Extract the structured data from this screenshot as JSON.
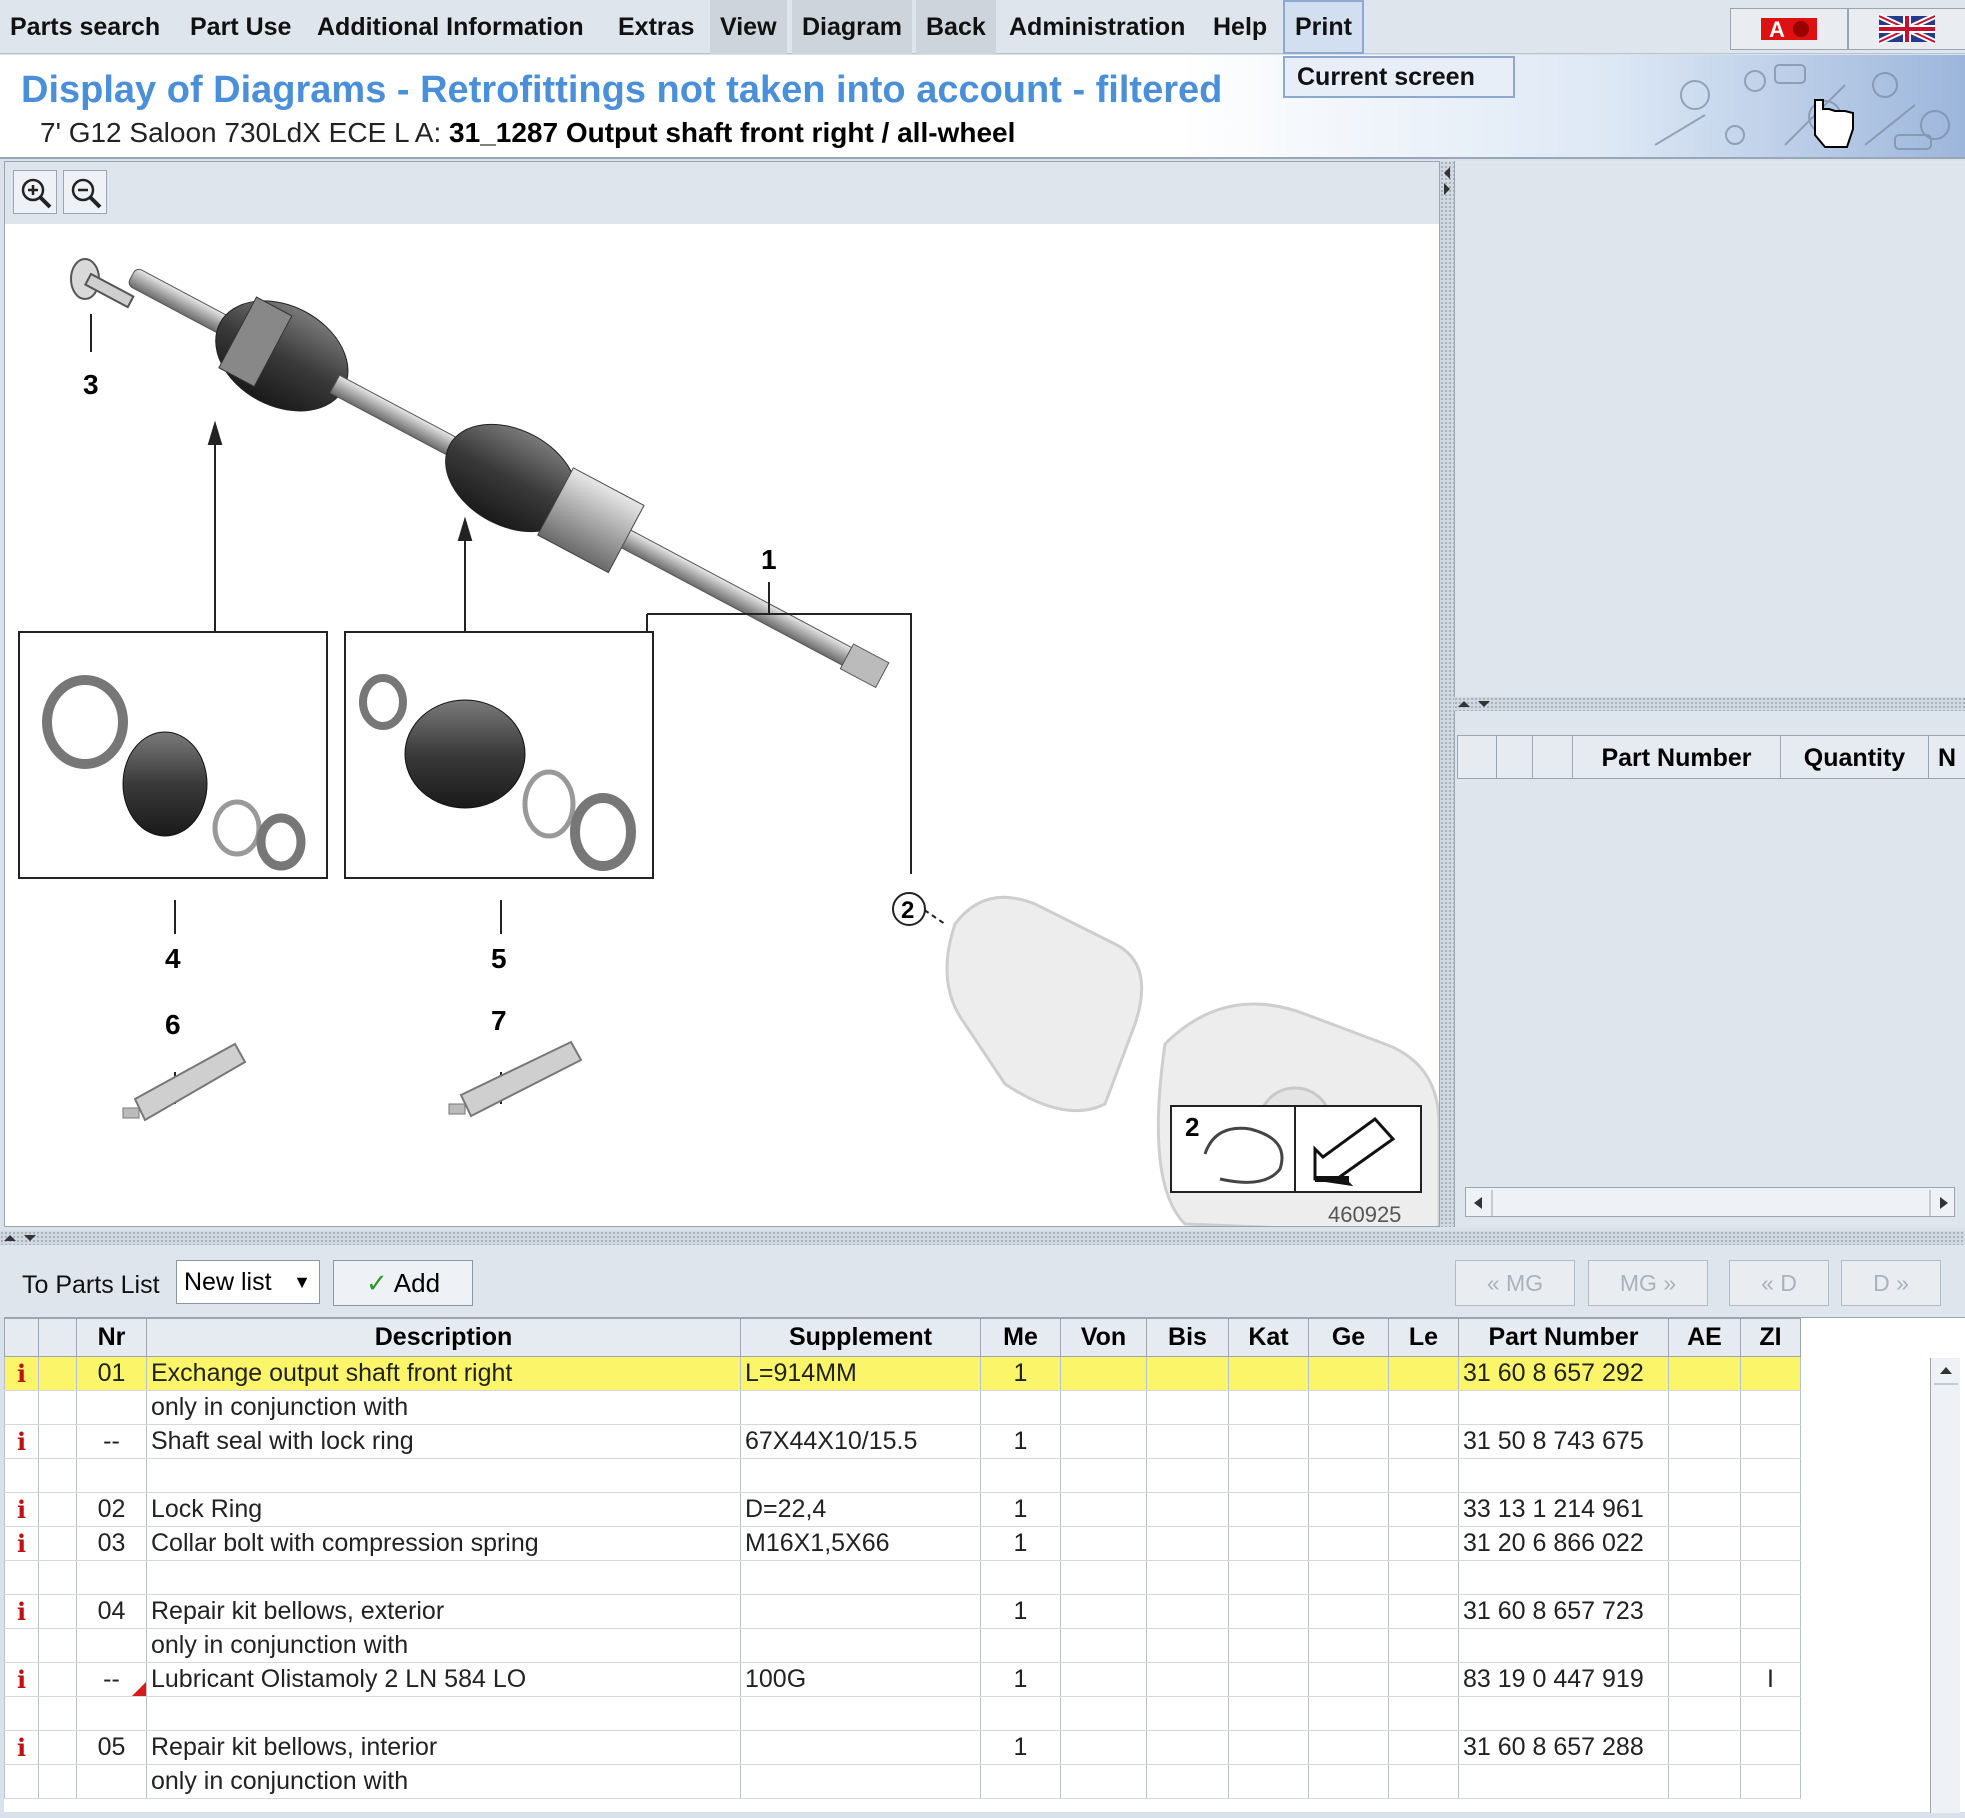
{
  "menu": {
    "items": [
      "Parts search",
      "Part Use",
      "Additional Information",
      "Extras",
      "View",
      "Diagram",
      "Back",
      "Administration",
      "Help",
      "Print"
    ],
    "print_dropdown": "Current screen"
  },
  "header": {
    "title": "Display of Diagrams - Retrofittings not taken into account - filtered",
    "vehicle": "7' G12 Saloon 730LdX ECE  L A:",
    "diagram_name": "31_1287 Output shaft front right / all-wheel"
  },
  "diagram": {
    "callouts": [
      "1",
      "2",
      "3",
      "4",
      "5",
      "6",
      "7"
    ],
    "image_number": "460925",
    "nav_box_number": "2"
  },
  "right_list": {
    "columns": [
      "",
      "",
      "",
      "Part Number",
      "Quantity",
      "N"
    ]
  },
  "toolbar": {
    "to_parts_list_label": "To Parts List",
    "list_select_value": "New list",
    "add_label": "Add",
    "nav": [
      "« MG",
      "MG »",
      "« D",
      "D »"
    ]
  },
  "table": {
    "columns": [
      "",
      "",
      "Nr",
      "Description",
      "Supplement",
      "Me",
      "Von",
      "Bis",
      "Kat",
      "Ge",
      "Le",
      "Part Number",
      "AE",
      "ZI"
    ],
    "rows": [
      {
        "info": true,
        "nr": "01",
        "desc": "Exchange output shaft front right",
        "supp": "L=914MM",
        "me": "1",
        "pn": "31 60 8 657 292",
        "zi": "",
        "highlight": true
      },
      {
        "info": false,
        "nr": "",
        "desc": "only in conjunction with",
        "supp": "",
        "me": "",
        "pn": "",
        "zi": ""
      },
      {
        "info": true,
        "nr": "--",
        "desc": "Shaft seal with lock ring",
        "supp": "67X44X10/15.5",
        "me": "1",
        "pn": "31 50 8 743 675",
        "zi": ""
      },
      {
        "info": false,
        "nr": "",
        "desc": "",
        "supp": "",
        "me": "",
        "pn": "",
        "zi": ""
      },
      {
        "info": true,
        "nr": "02",
        "desc": "Lock Ring",
        "supp": "D=22,4",
        "me": "1",
        "pn": "33 13 1 214 961",
        "zi": ""
      },
      {
        "info": true,
        "nr": "03",
        "desc": "Collar bolt with compression spring",
        "supp": "M16X1,5X66",
        "me": "1",
        "pn": "31 20 6 866 022",
        "zi": ""
      },
      {
        "info": false,
        "nr": "",
        "desc": "",
        "supp": "",
        "me": "",
        "pn": "",
        "zi": ""
      },
      {
        "info": true,
        "nr": "04",
        "desc": "Repair kit bellows, exterior",
        "supp": "",
        "me": "1",
        "pn": "31 60 8 657 723",
        "zi": ""
      },
      {
        "info": false,
        "nr": "",
        "desc": "only in conjunction with",
        "supp": "",
        "me": "",
        "pn": "",
        "zi": ""
      },
      {
        "info": true,
        "nr": "--",
        "desc": "Lubricant Olistamoly 2 LN 584 LO",
        "supp": "100G",
        "me": "1",
        "pn": "83 19 0 447 919",
        "zi": "I",
        "flag": true
      },
      {
        "info": false,
        "nr": "",
        "desc": "",
        "supp": "",
        "me": "",
        "pn": "",
        "zi": ""
      },
      {
        "info": true,
        "nr": "05",
        "desc": "Repair kit bellows, interior",
        "supp": "",
        "me": "1",
        "pn": "31 60 8 657 288",
        "zi": ""
      },
      {
        "info": false,
        "nr": "",
        "desc": "only in conjunction with",
        "supp": "",
        "me": "",
        "pn": "",
        "zi": ""
      }
    ]
  },
  "colors": {
    "title": "#4a8fd8",
    "highlight_row": "#fbf56a",
    "info_icon": "#c01010"
  }
}
